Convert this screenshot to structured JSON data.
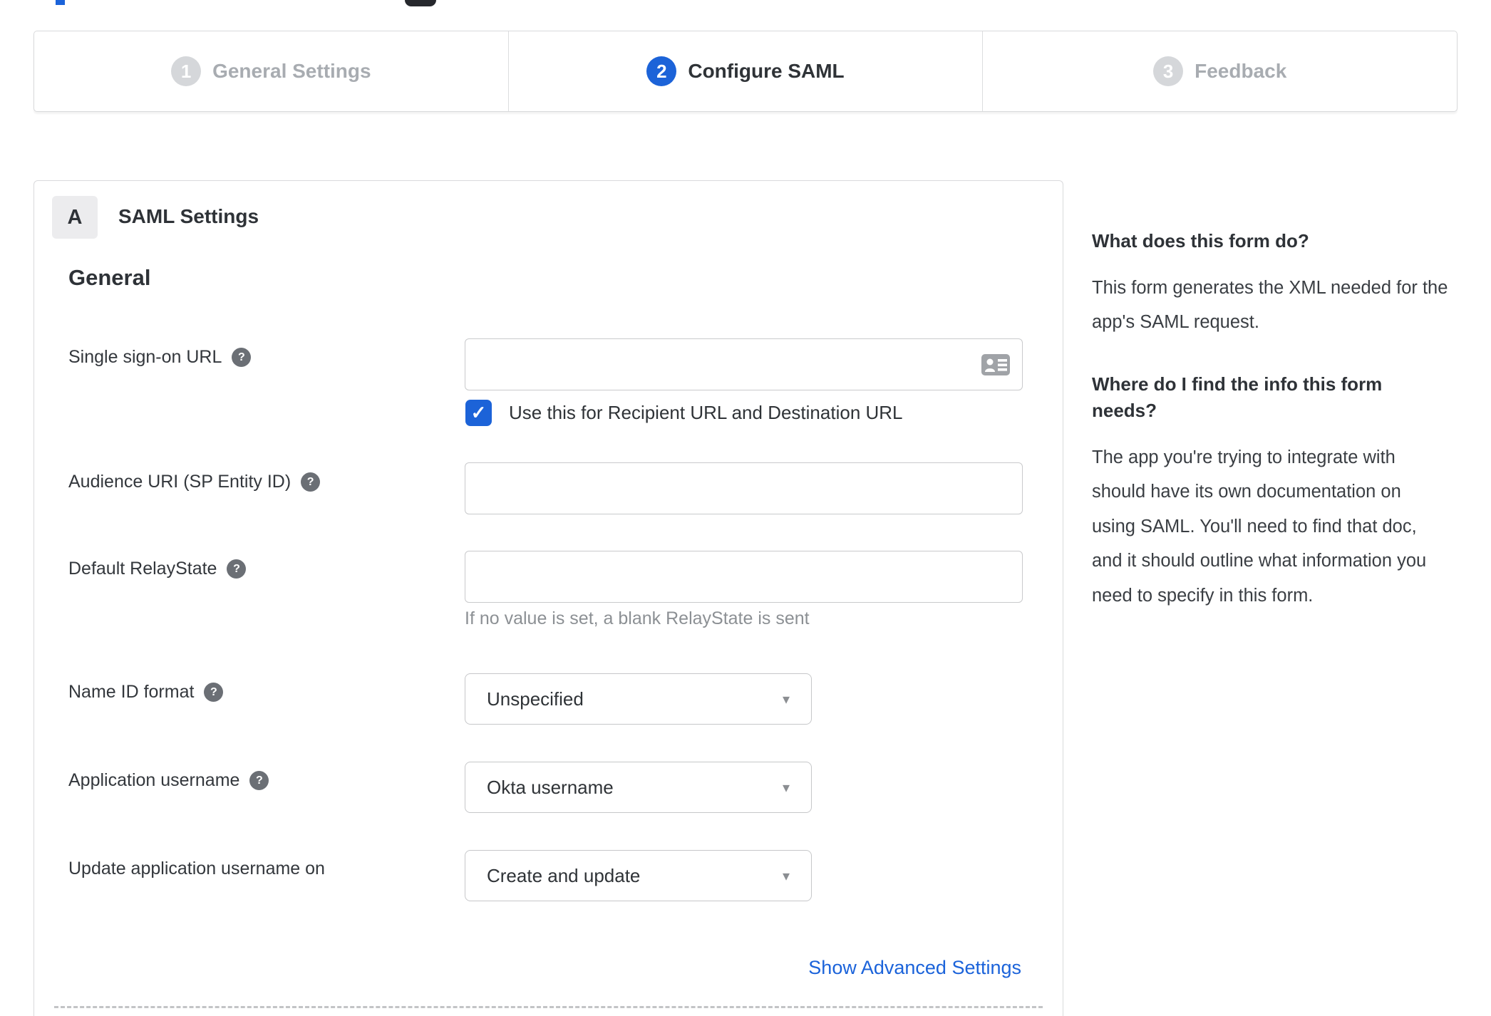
{
  "colors": {
    "accent_blue": "#1c63d8",
    "link_blue": "#1b63da",
    "inactive_grey": "#a8acb1",
    "border_grey": "#d9dadc",
    "hint_grey": "#8c9094"
  },
  "icons": {
    "help": "?",
    "check": "✓",
    "caret": "▾"
  },
  "stepper": {
    "steps": [
      {
        "number": "1",
        "label": "General Settings",
        "state": "inactive"
      },
      {
        "number": "2",
        "label": "Configure SAML",
        "state": "active"
      },
      {
        "number": "3",
        "label": "Feedback",
        "state": "inactive"
      }
    ]
  },
  "panel": {
    "section_badge": "A",
    "section_title": "SAML Settings",
    "group_title": "General",
    "fields": {
      "sso": {
        "label": "Single sign-on URL",
        "value": "",
        "checkbox_label": "Use this for Recipient URL and Destination URL",
        "checkbox_checked": true
      },
      "audience": {
        "label": "Audience URI (SP Entity ID)",
        "value": ""
      },
      "relay": {
        "label": "Default RelayState",
        "value": "",
        "hint": "If no value is set, a blank RelayState is sent"
      },
      "name_id": {
        "label": "Name ID format",
        "selected": "Unspecified"
      },
      "app_username": {
        "label": "Application username",
        "selected": "Okta username"
      },
      "update_username": {
        "label": "Update application username on",
        "selected": "Create and update"
      }
    },
    "advanced_link": "Show Advanced Settings"
  },
  "sidebar": {
    "q1": "What does this form do?",
    "a1": "This form generates the XML needed for the app's SAML request.",
    "q2": "Where do I find the info this form needs?",
    "a2": "The app you're trying to integrate with should have its own documentation on using SAML. You'll need to find that doc, and it should outline what information you need to specify in this form."
  }
}
